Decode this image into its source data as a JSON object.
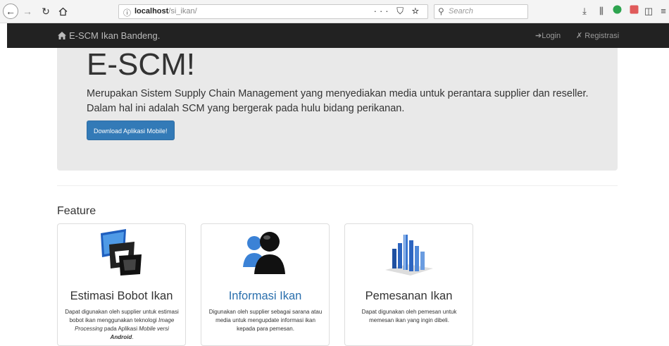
{
  "browser": {
    "url_host": "localhost",
    "url_path": "/si_ikan/",
    "page_actions": "··· ⛉ ☆",
    "search_placeholder": "Search"
  },
  "navbar": {
    "brand": "E-SCM Ikan Bandeng.",
    "login": "Login",
    "register": "Registrasi"
  },
  "jumbotron": {
    "title": "E-SCM!",
    "text": "Merupakan Sistem Supply Chain Management yang menyediakan media untuk perantara supplier dan reseller. Dalam hal ini adalah SCM yang bergerak pada hulu bidang perikanan.",
    "button": "Download Aplikasi Mobile!"
  },
  "features": {
    "heading": "Feature",
    "cards": [
      {
        "title": "Estimasi Bobot Ikan",
        "text_1": "Dapat digunakan oleh supplier untuk estimasi bobot ikan menggunakan teknologi ",
        "text_em1": "Image Processing",
        "text_2": " pada Aplikasi ",
        "text_em2": "Mobile versi",
        "text_3": " ",
        "text_bold": "Android",
        "text_4": "."
      },
      {
        "title": "Informasi Ikan",
        "text": "Digunakan oleh supplier sebagai sarana atau media untuk mengupdate informasi ikan kepada para pemesan."
      },
      {
        "title": "Pemesanan Ikan",
        "text": "Dapat digunakan oleh pemesan untuk memesan ikan yang ingin dibeli."
      }
    ]
  },
  "colors": {
    "navbar": "#222222",
    "jumbotron": "#e9e9e9",
    "primary": "#337ab7",
    "link": "#2a6fad"
  }
}
